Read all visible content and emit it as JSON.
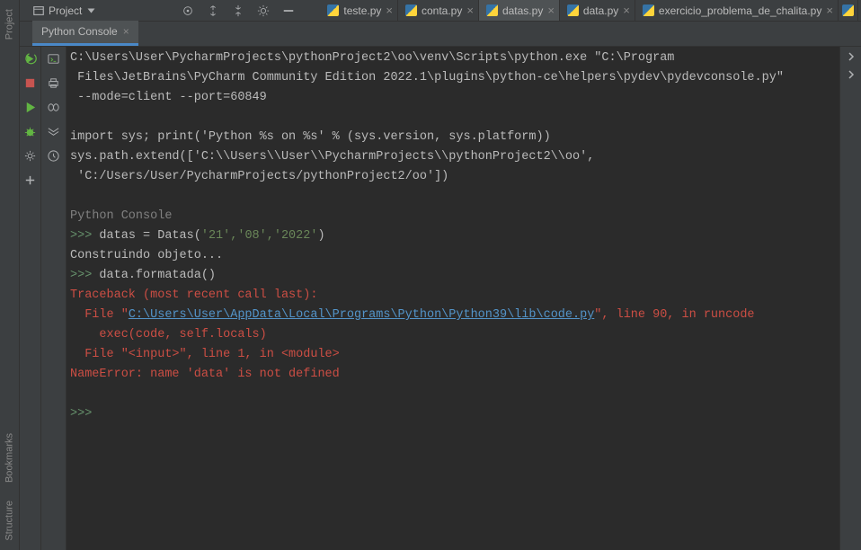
{
  "gutter": {
    "project": "Project",
    "bookmarks": "Bookmarks",
    "structure": "Structure"
  },
  "toolbar": {
    "project_label": "Project"
  },
  "tabs": [
    {
      "label": "teste.py",
      "active": false
    },
    {
      "label": "conta.py",
      "active": false
    },
    {
      "label": "datas.py",
      "active": true
    },
    {
      "label": "data.py",
      "active": false
    },
    {
      "label": "exercicio_problema_de_chalita.py",
      "active": false
    }
  ],
  "toolTab": {
    "label": "Python Console"
  },
  "console": {
    "header1": "C:\\Users\\User\\PycharmProjects\\pythonProject2\\oo\\venv\\Scripts\\python.exe \"C:\\Program",
    "header2": " Files\\JetBrains\\PyCharm Community Edition 2022.1\\plugins\\python-ce\\helpers\\pydev\\pydevconsole.py\"",
    "header3": " --mode=client --port=60849",
    "import_line": "import sys; print('Python %s on %s' % (sys.version, sys.platform))",
    "path_line1": "sys.path.extend(['C:\\\\Users\\\\User\\\\PycharmProjects\\\\pythonProject2\\\\oo',",
    "path_line2": " 'C:/Users/User/PycharmProjects/pythonProject2/oo'])",
    "pc_label": "Python Console",
    "prompt": ">>>",
    "in1_pre": " datas = Datas(",
    "in1_args": "'21','08','2022'",
    "in1_post": ")",
    "out1": "Construindo objeto...",
    "in2": " data.formatada()",
    "tb1": "Traceback (most recent call last):",
    "tb2a": "  File \"",
    "tb2_link": "C:\\Users\\User\\AppData\\Local\\Programs\\Python\\Python39\\lib\\code.py",
    "tb2b": "\", line 90, in runcode",
    "tb3": "    exec(code, self.locals)",
    "tb4": "  File \"<input>\", line 1, in <module>",
    "err": "NameError: name 'data' is not defined"
  }
}
